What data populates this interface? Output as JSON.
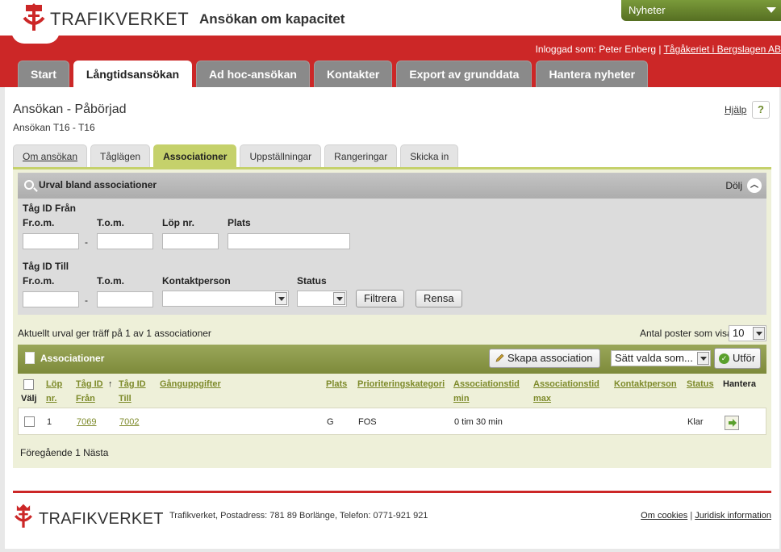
{
  "header": {
    "brand": "TRAFIKVERKET",
    "app_title": "Ansökan om kapacitet",
    "news_dropdown": "Nyheter",
    "logged_in_prefix": "Inloggad som: Peter Enberg |",
    "company_link": "Tågåkeriet i Bergslagen AB"
  },
  "main_tabs": [
    "Start",
    "Långtidsansökan",
    "Ad hoc-ansökan",
    "Kontakter",
    "Export av grunddata",
    "Hantera nyheter"
  ],
  "main_tab_active": "Långtidsansökan",
  "page": {
    "title": "Ansökan - Påbörjad",
    "subtitle": "Ansökan T16 - T16",
    "help_link": "Hjälp",
    "help_icon": "?"
  },
  "sub_tabs": [
    "Om ansökan",
    "Tåglägen",
    "Associationer",
    "Uppställningar",
    "Rangeringar",
    "Skicka in"
  ],
  "sub_tab_active": "Associationer",
  "filter": {
    "title": "Urval bland associationer",
    "hide_label": "Dölj",
    "group_from": "Tåg ID Från",
    "group_to": "Tåg ID Till",
    "from_label": "Fr.o.m.",
    "to_label": "T.o.m.",
    "lop_label": "Löp nr.",
    "plats_label": "Plats",
    "contact_label": "Kontaktperson",
    "status_label": "Status",
    "separator": "-",
    "filter_button": "Filtrera",
    "clear_button": "Rensa"
  },
  "results": {
    "info": "Aktuellt urval ger träff på 1 av 1 associationer",
    "per_page_label": "Antal poster som visas:",
    "per_page_value": "10"
  },
  "assoc_table": {
    "title": "Associationer",
    "create_button": "Skapa association",
    "bulk_action_select": "Sätt valda som...",
    "execute_button": "Utför",
    "headers": {
      "valj": "Välj",
      "lop_nr": [
        "Löp",
        "nr."
      ],
      "tag_fran": [
        "Tåg ID",
        "Från"
      ],
      "sort_arrow": "↑",
      "tag_till": [
        "Tåg ID",
        "Till"
      ],
      "ganguppgifter": "Gånguppgifter",
      "plats": "Plats",
      "prio": "Prioriteringskategori",
      "assoc_min": [
        "Associationstid",
        "min"
      ],
      "assoc_max": [
        "Associationstid",
        "max"
      ],
      "kontakt": "Kontaktperson",
      "status": "Status",
      "hantera": "Hantera"
    },
    "rows": [
      {
        "lop": "1",
        "fran": "7069",
        "till": "7002",
        "gang": "",
        "plats": "G",
        "prio": "FOS",
        "min": "0 tim 30 min",
        "max": "",
        "kontakt": "",
        "status": "Klar"
      }
    ]
  },
  "pager": {
    "prev": "Föregående",
    "page": "1",
    "next": "Nästa"
  },
  "footer": {
    "brand": "TRAFIKVERKET",
    "address": "Trafikverket, Postadress: 781 89 Borlänge, Telefon: 0771-921 921",
    "cookies_link": "Om cookies",
    "separator": "|",
    "legal_link": "Juridisk information"
  },
  "colors": {
    "brand_red": "#cc2727",
    "accent_green": "#c5d16b",
    "table_header_olive": "#8a9648",
    "tab_gray": "#8a8a8a"
  }
}
